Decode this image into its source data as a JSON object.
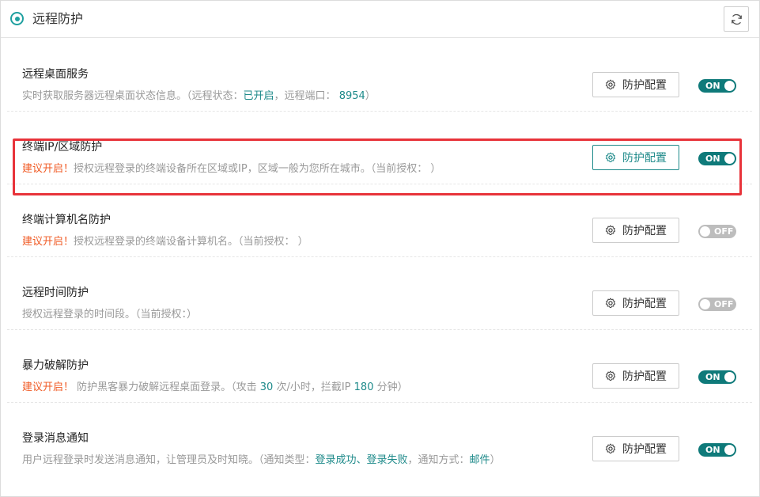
{
  "header": {
    "title": "远程防护",
    "refresh_icon": "refresh-icon",
    "title_icon": "target-icon"
  },
  "config_button_label": "防护配置",
  "rows": [
    {
      "title": "远程桌面服务",
      "desc_plain": "实时获取服务器远程桌面状态信息。（远程状态：",
      "status_value": "已开启",
      "desc_mid": "，远程端口：",
      "port_value": "8954",
      "desc_end": "）",
      "toggle": "ON"
    },
    {
      "title": "终端IP/区域防护",
      "warn": "建议开启！",
      "desc": "授权远程登录的终端设备所在区域或IP，区域一般为您所在城市。（当前授权：  ）",
      "toggle": "ON"
    },
    {
      "title": "终端计算机名防护",
      "warn": "建议开启！",
      "desc": "授权远程登录的终端设备计算机名。（当前授权：  ）",
      "toggle": "OFF"
    },
    {
      "title": "远程时间防护",
      "desc": "授权远程登录的时间段。（当前授权：）",
      "toggle": "OFF"
    },
    {
      "title": "暴力破解防护",
      "warn": "建议开启！",
      "desc_a": " 防护黑客暴力破解远程桌面登录。（攻击 ",
      "attack_count": "30",
      "desc_b": " 次/小时，拦截IP ",
      "block_minutes": "180",
      "desc_c": " 分钟）",
      "toggle": "ON"
    },
    {
      "title": "登录消息通知",
      "desc_a": "用户远程登录时发送消息通知，让管理员及时知晓。（通知类型：",
      "notify_types": "登录成功、登录失败",
      "desc_b": "，通知方式：",
      "notify_method": "邮件",
      "desc_c": "）",
      "toggle": "ON"
    }
  ],
  "colors": {
    "accent": "#1e8a8a",
    "warn": "#f05a24",
    "toggle_on": "#0f7a7a",
    "toggle_off": "#bdbdbd",
    "highlight": "#e8333a"
  }
}
